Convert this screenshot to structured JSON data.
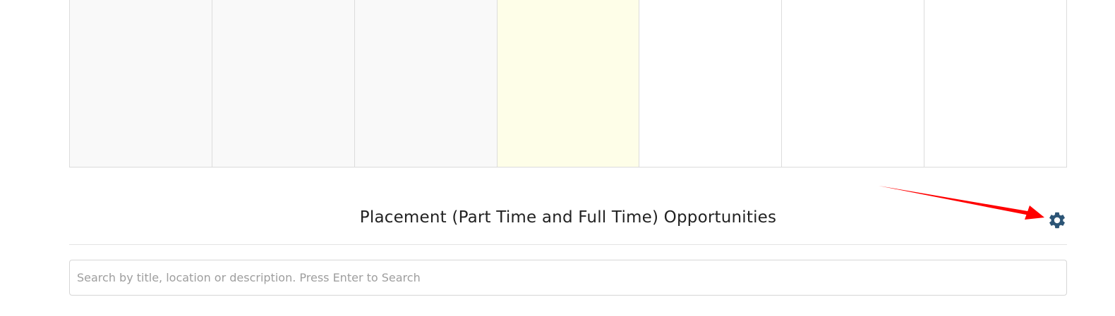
{
  "calendar": {
    "cells": [
      {
        "state": "past"
      },
      {
        "state": "past"
      },
      {
        "state": "past"
      },
      {
        "state": "today"
      },
      {
        "state": "future"
      },
      {
        "state": "future"
      },
      {
        "state": "future"
      }
    ]
  },
  "opportunities": {
    "title": "Placement (Part Time and Full Time) Opportunities",
    "settings_icon": "gear-icon",
    "search": {
      "placeholder": "Search by title, location or description. Press Enter to Search",
      "value": ""
    }
  },
  "colors": {
    "gear": "#2c5576",
    "annotation_arrow": "#ff0000",
    "today_highlight": "#fefee8",
    "past_cell": "#f9f9f9"
  }
}
